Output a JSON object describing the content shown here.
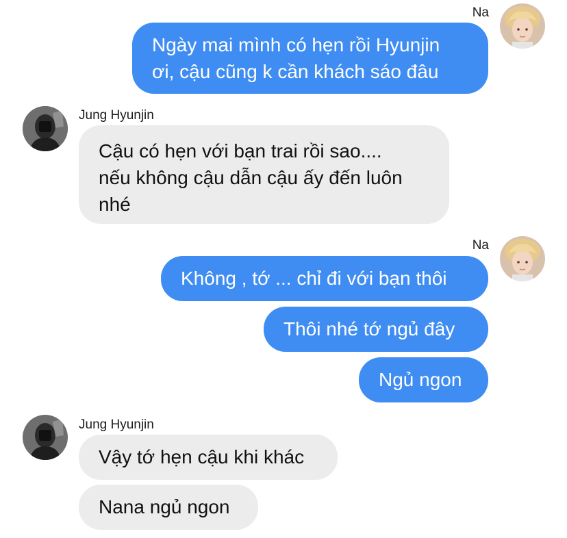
{
  "colors": {
    "outgoing_bubble": "#3f8df2",
    "incoming_bubble": "#ececec",
    "outgoing_text": "#ffffff",
    "incoming_text": "#111111"
  },
  "self": {
    "name": "Na",
    "avatar_icon": "user-avatar-blond-hair"
  },
  "contact": {
    "name": "Jung Hyunjin",
    "avatar_icon": "user-avatar-dark-grayscale"
  },
  "messages": [
    {
      "from": "self",
      "lines": [
        "Ngày mai mình có hẹn rồi Hyunjin",
        "ơi, cậu cũng k cần khách sáo đâu"
      ]
    },
    {
      "from": "contact",
      "lines": [
        "Cậu có hẹn với bạn trai rồi sao....",
        "nếu không cậu dẫn cậu ấy đến luôn",
        "nhé"
      ]
    },
    {
      "from": "self",
      "lines": [
        "Không , tớ ... chỉ đi với bạn thôi"
      ]
    },
    {
      "from": "self",
      "lines": [
        "Thôi nhé tớ ngủ đây"
      ]
    },
    {
      "from": "self",
      "lines": [
        "Ngủ ngon"
      ]
    },
    {
      "from": "contact",
      "lines": [
        "Vậy tớ hẹn cậu khi khác"
      ]
    },
    {
      "from": "contact",
      "lines": [
        "Nana ngủ ngon"
      ]
    }
  ]
}
